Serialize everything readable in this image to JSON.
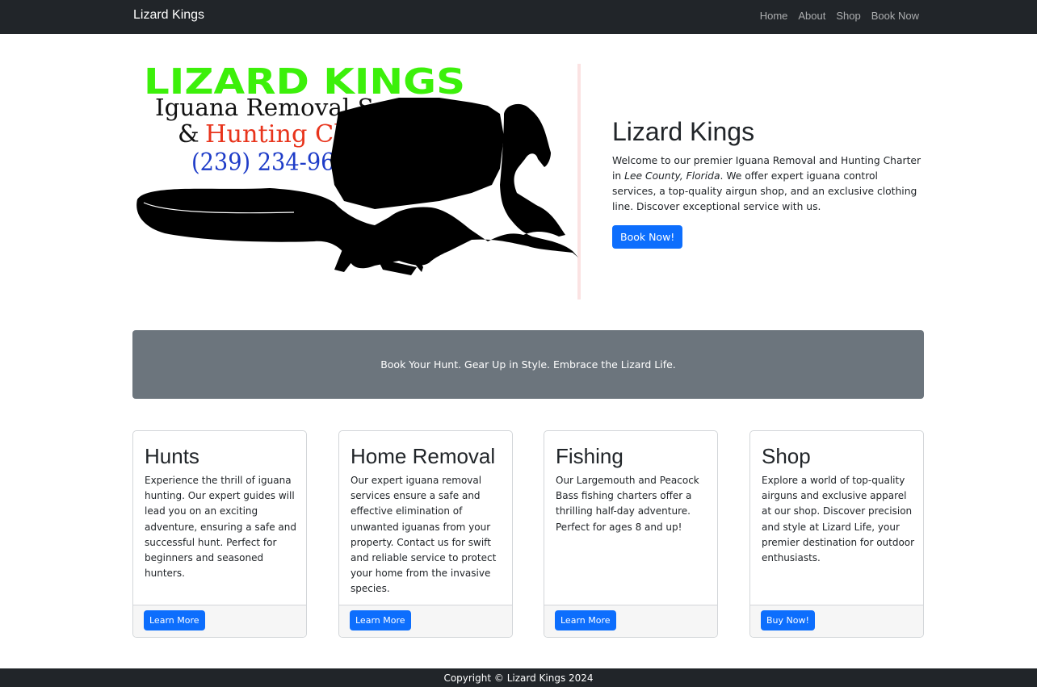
{
  "navbar": {
    "brand": "Lizard Kings",
    "links": [
      "Home",
      "About",
      "Shop",
      "Book Now"
    ]
  },
  "hero": {
    "image": {
      "line1": "LIZARD KINGS",
      "line2": "Iguana Removal Service",
      "line3_amp": "&",
      "line3_text": "Hunting Charter",
      "phone": "(239) 234-9608"
    },
    "title": "Lizard Kings",
    "body_before": "Welcome to our premier Iguana Removal and Hunting Charter in ",
    "body_italic": "Lee County, Florida",
    "body_after": ". We offer expert iguana control services, a top-quality airgun shop, and an exclusive clothing line. Discover exceptional service with us.",
    "cta": "Book Now!"
  },
  "banner": {
    "text": "Book Your Hunt. Gear Up in Style. Embrace the Lizard Life."
  },
  "cards": [
    {
      "title": "Hunts",
      "text": "Experience the thrill of iguana hunting. Our expert guides will lead you on an exciting adventure, ensuring a safe and successful hunt. Perfect for beginners and seasoned hunters.",
      "button": "Learn More"
    },
    {
      "title": "Home Removal",
      "text": "Our expert iguana removal services ensure a safe and effective elimination of unwanted iguanas from your property. Contact us for swift and reliable service to protect your home from the invasive species.",
      "button": "Learn More"
    },
    {
      "title": "Fishing",
      "text": "Our Largemouth and Peacock Bass fishing charters offer a thrilling half-day adventure. Perfect for ages 8 and up!",
      "button": "Learn More"
    },
    {
      "title": "Shop",
      "text": "Explore a world of top-quality airguns and exclusive apparel at our shop. Discover precision and style at Lizard Life, your premier destination for outdoor enthusiasts.",
      "button": "Buy Now!"
    }
  ],
  "footer": {
    "text": "Copyright © Lizard Kings 2024"
  },
  "colors": {
    "navbar": "#212529",
    "primary": "#0d6efd",
    "banner": "#6c757d",
    "logo_green": "#3cf00a",
    "logo_red": "#e8341c",
    "logo_blue": "#1e3cc8"
  },
  "icons": {
    "hero_image": "iguana-silhouette-logo"
  }
}
